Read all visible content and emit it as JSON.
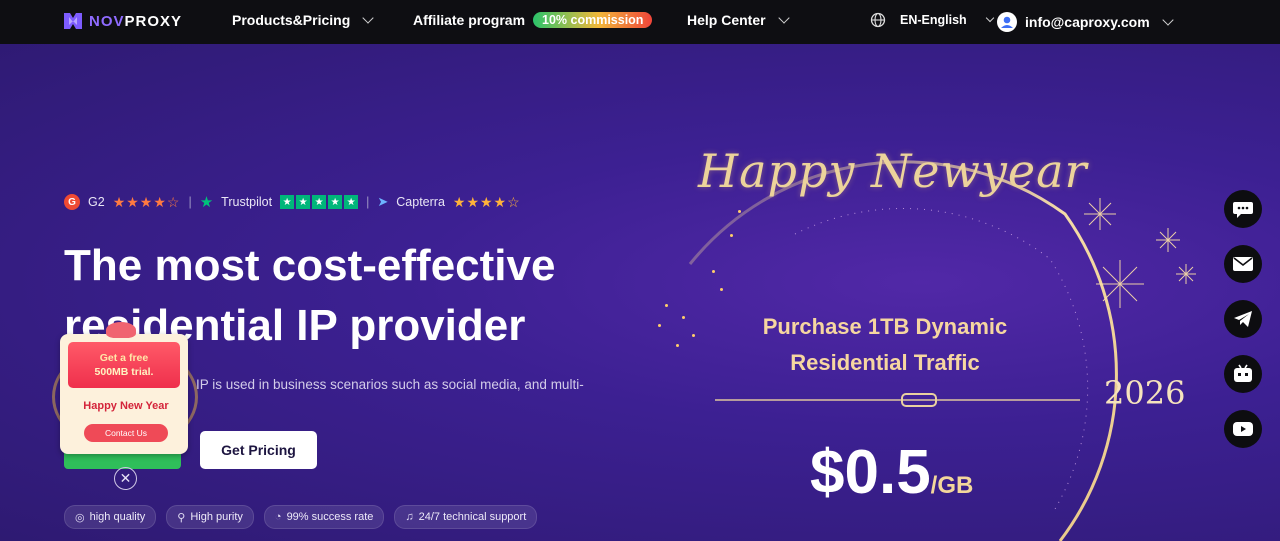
{
  "nav": {
    "logo_text_accent": "NOV",
    "logo_text": "PROXY",
    "products": "Products&Pricing",
    "affiliate": "Affiliate program",
    "affiliate_badge": "10% commission",
    "help": "Help Center",
    "language": "EN-English",
    "account": "info@caproxy.com"
  },
  "ratings": {
    "g2_label": "G2",
    "trustpilot_label": "Trustpilot",
    "capterra_label": "Capterra",
    "g2_stars": "★★★★☆",
    "trustpilot_stars": "★★★★★",
    "capterra_stars": "★★★★☆",
    "g2_rating": 4.5,
    "trustpilot_rating": 5,
    "capterra_rating": 4.5
  },
  "hero": {
    "title_line1": "The most cost-effective",
    "title_line2": "residential IP provider",
    "subtitle": "IP is used in business scenarios such as social media, and multi-",
    "get_pricing": "Get Pricing",
    "close_symbol": "✕"
  },
  "features": [
    {
      "icon": "quality-icon",
      "label": "high quality"
    },
    {
      "icon": "purity-icon",
      "label": "High purity"
    },
    {
      "icon": "speed-icon",
      "label": "99% success rate"
    },
    {
      "icon": "headset-icon",
      "label": "24/7 technical support"
    }
  ],
  "promo": {
    "line1": "Get a free",
    "line2": "500MB trial.",
    "greeting": "Happy New Year",
    "contact": "Contact Us"
  },
  "banner": {
    "greeting": "Happy Newyear",
    "offer_line1": "Purchase 1TB Dynamic",
    "offer_line2": "Residential Traffic",
    "year": "2026",
    "price": "$0.5",
    "unit": "/GB"
  },
  "side_buttons": [
    "chat-icon",
    "mail-icon",
    "telegram-icon",
    "bot-icon",
    "youtube-icon"
  ],
  "colors": {
    "hero_bg": "#3c2092",
    "topbar_bg": "#0e0e12",
    "accent_gold": "#ecd39b",
    "brand_purple": "#8f6bff"
  }
}
